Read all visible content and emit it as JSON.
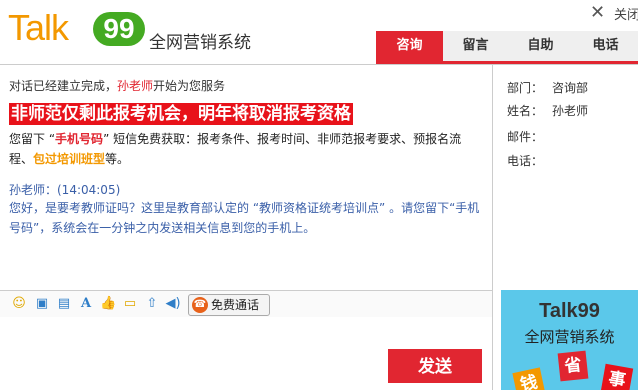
{
  "header": {
    "logo_text": "Talk",
    "logo_num": "99",
    "logo_sub": "全网营销系统",
    "close_label": "关闭"
  },
  "tabs": [
    {
      "label": "咨询",
      "active": true
    },
    {
      "label": "留言",
      "active": false
    },
    {
      "label": "自助",
      "active": false
    },
    {
      "label": "电话",
      "active": false
    }
  ],
  "chat": {
    "system_pre": "对话已经建立完成，",
    "system_teacher": "孙老师",
    "system_post": "开始为您服务",
    "banner": "非师范仅剩此报考机会，明年将取消报考资格",
    "p1_a": "您留下  “",
    "p1_phone": "手机号码",
    "p1_b": "”  短信免费获取：报考条件、报考时间、非师范报考要求、预报名流程、",
    "p1_course": "包过培训班型",
    "p1_c": "等。",
    "msg_name": "孙老师：(14:04:05)",
    "msg_text": "您好，是要考教师证吗？这里是教育部认定的  “教师资格证统考培训点”  。请您留下“手机号码”，系统会在一分钟之内发送相关信息到您的手机上。"
  },
  "toolbar": {
    "icons": [
      "emoji-icon",
      "image-icon",
      "screenshot-icon",
      "font-icon",
      "like-icon",
      "chat-history-icon",
      "upload-icon",
      "sound-icon"
    ],
    "call_label": "免费通话"
  },
  "send_label": "发送",
  "info": {
    "dept_label": "部门：",
    "dept_value": "咨询部",
    "name_label": "姓名：",
    "name_value": "孙老师",
    "email_label": "邮件：",
    "email_value": "",
    "phone_label": "电话：",
    "phone_value": ""
  },
  "ad": {
    "title": "Talk99",
    "sub": "全网营销系统",
    "tiles": [
      "钱",
      "省",
      "事"
    ]
  },
  "colors": {
    "accent": "#e12631",
    "orange": "#f39800",
    "green": "#44aa22"
  }
}
